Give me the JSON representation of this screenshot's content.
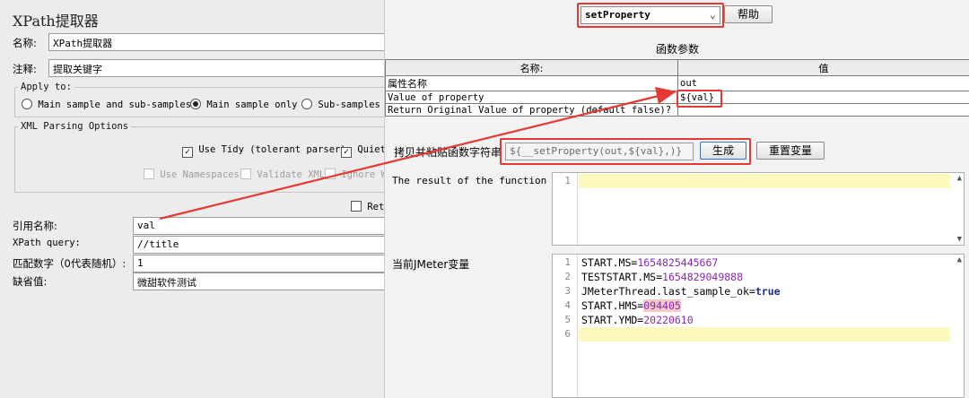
{
  "left": {
    "title": "XPath提取器",
    "name_label": "名称:",
    "name_value": "XPath提取器",
    "comment_label": "注释:",
    "comment_value": "提取关键字",
    "apply_to": {
      "title": "Apply to:",
      "options": [
        "Main sample and sub-samples",
        "Main sample only",
        "Sub-samples o"
      ],
      "selected": 1
    },
    "xml_options": {
      "title": "XML Parsing Options",
      "use_tidy": "Use Tidy (tolerant parser)",
      "quiet": "Quiet",
      "use_namespaces": "Use Namespaces",
      "validate_xml": "Validate XML",
      "ignore_whitespace": "Ignore Wh"
    },
    "return_check": "Retu",
    "ref_name_label": "引用名称:",
    "ref_name_value": "val",
    "xpath_label": "XPath query:",
    "xpath_value": "//title",
    "match_no_label": "匹配数字（0代表随机）:",
    "match_no_value": "1",
    "default_label": "缺省值:",
    "default_value": "微甜软件测试"
  },
  "right": {
    "function_select": "setProperty",
    "help_button": "帮助",
    "params_title": "函数参数",
    "params_table": {
      "headers": [
        "名称:",
        "值"
      ],
      "rows": [
        [
          "属性名称",
          "out"
        ],
        [
          "Value of property",
          "${val}"
        ],
        [
          "Return Original Value of property (default false)?",
          ""
        ]
      ]
    },
    "copy_label": "拷贝并粘贴函数字符串",
    "function_string": "${__setProperty(out,${val},)}",
    "generate_button": "生成",
    "reset_button": "重置变量",
    "result_label": "The result of the function is",
    "result_lines": [
      "1"
    ],
    "vars_label": "当前JMeter变量",
    "vars_lines": [
      {
        "num": "1",
        "key": "START.MS=",
        "val": "1654825445667"
      },
      {
        "num": "2",
        "key": "TESTSTART.MS=",
        "val": "1654829049888"
      },
      {
        "num": "3",
        "key": "JMeterThread.last_sample_ok=",
        "val": "true"
      },
      {
        "num": "4",
        "key": "START.HMS=",
        "val": "094405"
      },
      {
        "num": "5",
        "key": "START.YMD=",
        "val": "20220610"
      },
      {
        "num": "6",
        "key": "",
        "val": ""
      }
    ]
  },
  "colors": {
    "highlight_box": "#e53935",
    "arrow": "#e53935",
    "value_purple": "#8b26b6",
    "current_line": "#fbf9bc"
  }
}
